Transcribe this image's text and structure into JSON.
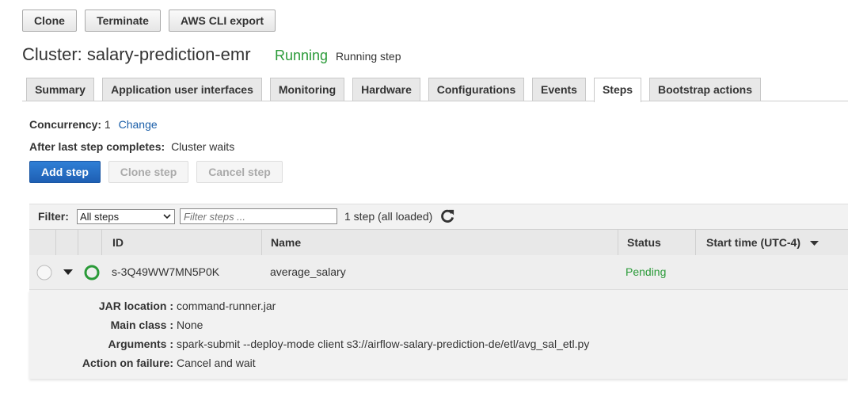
{
  "toolbar": {
    "clone_label": "Clone",
    "terminate_label": "Terminate",
    "cli_export_label": "AWS CLI export"
  },
  "cluster": {
    "title": "Cluster: salary-prediction-emr",
    "status": "Running",
    "status_detail": "Running step"
  },
  "tabs": [
    {
      "label": "Summary"
    },
    {
      "label": "Application user interfaces"
    },
    {
      "label": "Monitoring"
    },
    {
      "label": "Hardware"
    },
    {
      "label": "Configurations"
    },
    {
      "label": "Events"
    },
    {
      "label": "Steps",
      "active": true
    },
    {
      "label": "Bootstrap actions"
    }
  ],
  "steps": {
    "concurrency_label": "Concurrency:",
    "concurrency_value": "1",
    "change_link": "Change",
    "after_label": "After last step completes:",
    "after_value": "Cluster waits",
    "add_label": "Add step",
    "clone_label": "Clone step",
    "cancel_label": "Cancel step"
  },
  "filter": {
    "label": "Filter:",
    "selected": "All steps",
    "placeholder": "Filter steps ...",
    "count": "1 step (all loaded)"
  },
  "table": {
    "columns": [
      "ID",
      "Name",
      "Status",
      "Start time (UTC-4)"
    ],
    "rows": [
      {
        "id": "s-3Q49WW7MN5P0K",
        "name": "average_salary",
        "status": "Pending"
      }
    ]
  },
  "details": [
    {
      "key": "JAR location :",
      "value": "command-runner.jar"
    },
    {
      "key": "Main class :",
      "value": "None"
    },
    {
      "key": "Arguments :",
      "value": "spark-submit --deploy-mode client s3://airflow-salary-prediction-de/etl/avg_sal_etl.py"
    },
    {
      "key": "Action on failure:",
      "value": "Cancel and wait"
    }
  ],
  "colors": {
    "running": "#2a9a38",
    "pending": "#2a9a38",
    "link": "#1a5ea8",
    "primary": "#1e5fb3"
  }
}
